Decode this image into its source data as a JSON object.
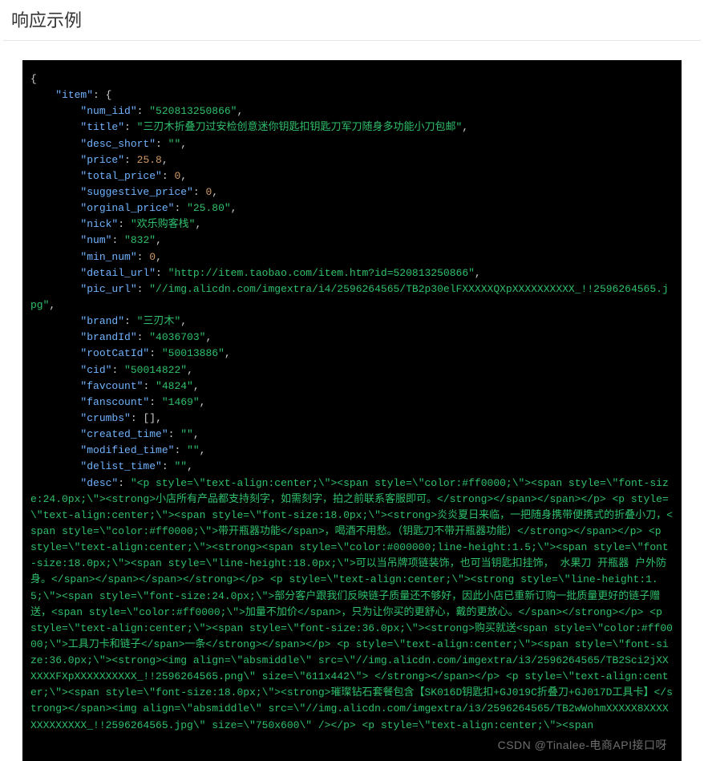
{
  "heading": "响应示例",
  "watermark": "CSDN @Tinalee-电商API接口呀",
  "code": {
    "indent1": "    ",
    "indent2": "        ",
    "open": "{",
    "item_key": "\"item\"",
    "colon_brace": ": {",
    "lines": [
      {
        "key": "\"num_iid\"",
        "sep": ": ",
        "val": "\"520813250866\"",
        "tail": ","
      },
      {
        "key": "\"title\"",
        "sep": ": ",
        "val": "\"三刃木折叠刀过安检创意迷你钥匙扣钥匙刀军刀随身多功能小刀包邮\"",
        "tail": ","
      },
      {
        "key": "\"desc_short\"",
        "sep": ": ",
        "val": "\"\"",
        "tail": ","
      },
      {
        "key": "\"price\"",
        "sep": ": ",
        "valnum": "25.8",
        "tail": ","
      },
      {
        "key": "\"total_price\"",
        "sep": ": ",
        "valnum": "0",
        "tail": ","
      },
      {
        "key": "\"suggestive_price\"",
        "sep": ": ",
        "valnum": "0",
        "tail": ","
      },
      {
        "key": "\"orginal_price\"",
        "sep": ": ",
        "val": "\"25.80\"",
        "tail": ","
      },
      {
        "key": "\"nick\"",
        "sep": ": ",
        "val": "\"欢乐购客栈\"",
        "tail": ","
      },
      {
        "key": "\"num\"",
        "sep": ": ",
        "val": "\"832\"",
        "tail": ","
      },
      {
        "key": "\"min_num\"",
        "sep": ": ",
        "valnum": "0",
        "tail": ","
      },
      {
        "key": "\"detail_url\"",
        "sep": ": ",
        "val": "\"http://item.taobao.com/item.htm?id=520813250866\"",
        "tail": ","
      },
      {
        "key": "\"pic_url\"",
        "sep": ": ",
        "val": "\"//img.alicdn.com/imgextra/i4/2596264565/TB2p30elFXXXXXQXpXXXXXXXXXX_!!2596264565.jpg\"",
        "tail": ",",
        "wrap": true
      },
      {
        "key": "\"brand\"",
        "sep": ": ",
        "val": "\"三刃木\"",
        "tail": ","
      },
      {
        "key": "\"brandId\"",
        "sep": ": ",
        "val": "\"4036703\"",
        "tail": ","
      },
      {
        "key": "\"rootCatId\"",
        "sep": ": ",
        "val": "\"50013886\"",
        "tail": ","
      },
      {
        "key": "\"cid\"",
        "sep": ": ",
        "val": "\"50014822\"",
        "tail": ","
      },
      {
        "key": "\"favcount\"",
        "sep": ": ",
        "val": "\"4824\"",
        "tail": ","
      },
      {
        "key": "\"fanscount\"",
        "sep": ": ",
        "val": "\"1469\"",
        "tail": ","
      },
      {
        "key": "\"crumbs\"",
        "sep": ": [",
        "raw": "]",
        "tail": ","
      },
      {
        "key": "\"created_time\"",
        "sep": ": ",
        "val": "\"\"",
        "tail": ","
      },
      {
        "key": "\"modified_time\"",
        "sep": ": ",
        "val": "\"\"",
        "tail": ","
      },
      {
        "key": "\"delist_time\"",
        "sep": ": ",
        "val": "\"\"",
        "tail": ","
      }
    ],
    "desc_key": "\"desc\"",
    "desc_sep": ": ",
    "desc_val": "\"<p style=\\\"text-align:center;\\\"><span style=\\\"color:#ff0000;\\\"><span style=\\\"font-size:24.0px;\\\"><strong>小店所有产品都支持刻字，如需刻字，拍之前联系客服即可。</strong></span></span></p> <p style=\\\"text-align:center;\\\"><span style=\\\"font-size:18.0px;\\\"><strong>炎炎夏日来临，一把随身携带便携式的折叠小刀，<span style=\\\"color:#ff0000;\\\">带开瓶器功能</span>，喝酒不用愁。（钥匙刀不带开瓶器功能）</strong></span></p> <p style=\\\"text-align:center;\\\"><strong><span style=\\\"color:#000000;line-height:1.5;\\\"><span style=\\\"font-size:18.0px;\\\"><span style=\\\"line-height:18.0px;\\\">可以当吊牌项链装饰，也可当钥匙扣挂饰， 水果刀 开瓶器 户外防身。</span></span></span></strong></p> <p style=\\\"text-align:center;\\\"><strong style=\\\"line-height:1.5;\\\"><span style=\\\"font-size:24.0px;\\\">部分客户跟我们反映链子质量还不够好，因此小店已重新订购一批质量更好的链子赠送，<span style=\\\"color:#ff0000;\\\">加量不加价</span>，只为让你买的更舒心，戴的更放心。</span></strong></p> <p style=\\\"text-align:center;\\\"><span style=\\\"font-size:36.0px;\\\"><strong>购买就送<span style=\\\"color:#ff0000;\\\">工具刀卡和链子</span>一条</strong></span></p> <p style=\\\"text-align:center;\\\"><span style=\\\"font-size:36.0px;\\\"><strong><img align=\\\"absmiddle\\\" src=\\\"//img.alicdn.com/imgextra/i3/2596264565/TB2Sci2jXXXXXXFXpXXXXXXXXXX_!!2596264565.png\\\" size=\\\"611x442\\\"> </strong></span></p> <p style=\\\"text-align:center;\\\"><span style=\\\"font-size:18.0px;\\\"><strong>璀璨钻石套餐包含【SK016D钥匙扣+GJ019C折叠刀+GJ017D工具卡】</strong></span><img align=\\\"absmiddle\\\" src=\\\"//img.alicdn.com/imgextra/i3/2596264565/TB2wWohmXXXXX8XXXXXXXXXXXXX_!!2596264565.jpg\\\" size=\\\"750x600\\\" /></p> <p style=\\\"text-align:center;\\\"><span"
  }
}
